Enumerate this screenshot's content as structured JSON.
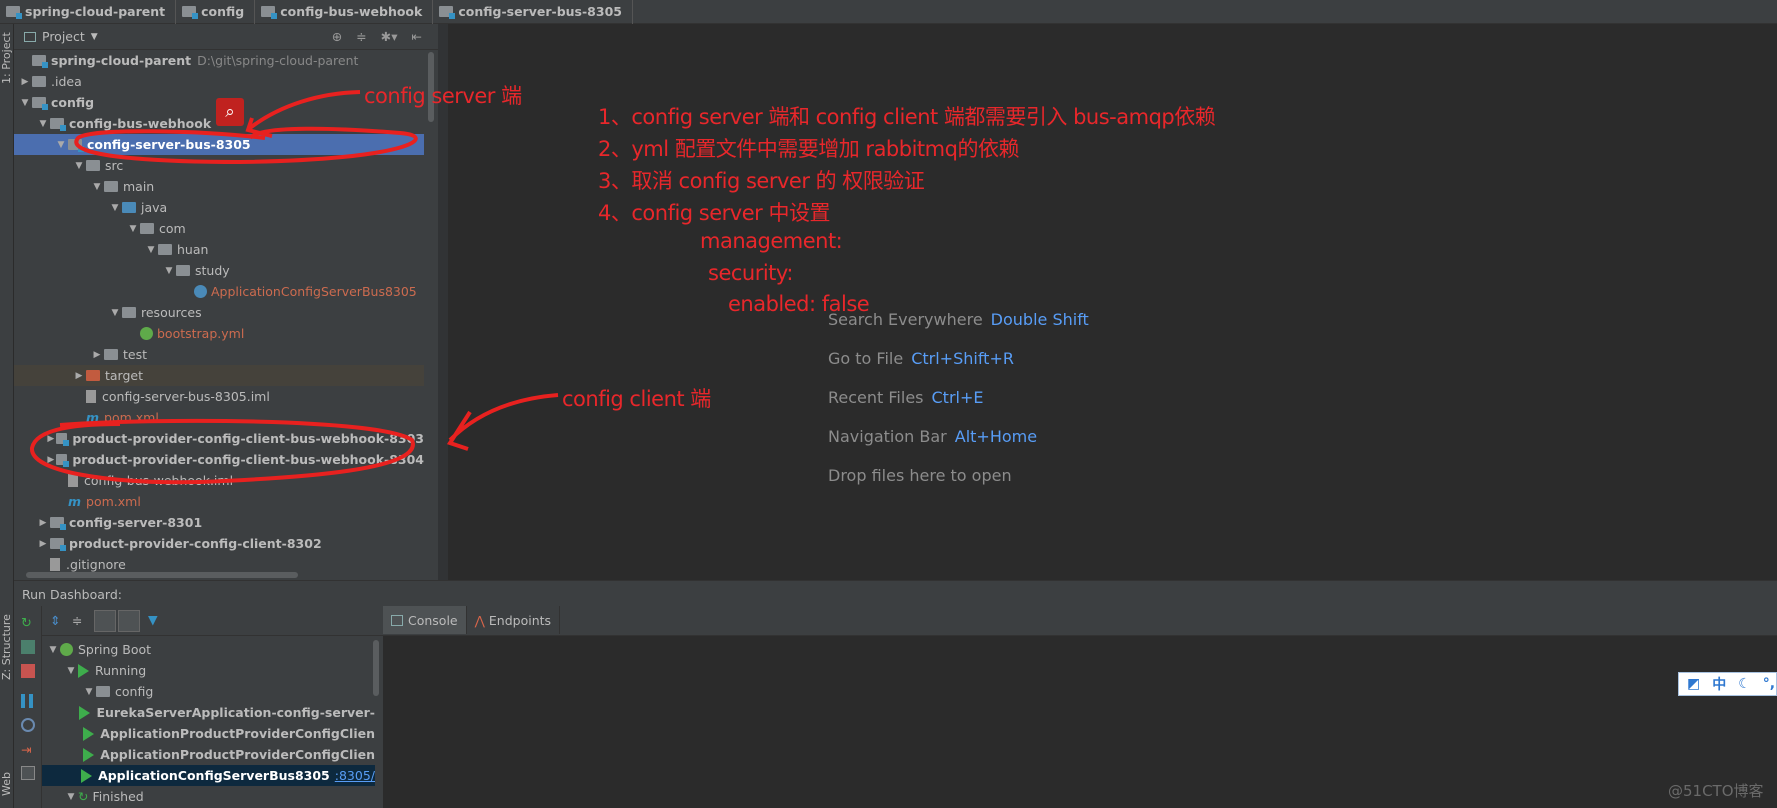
{
  "breadcrumb": [
    "spring-cloud-parent",
    "config",
    "config-bus-webhook",
    "config-server-bus-8305"
  ],
  "left_strip": {
    "project": "1: Project",
    "structure": "Z: Structure",
    "web": "Web"
  },
  "project_panel": {
    "title": "Project",
    "tree": [
      {
        "label": "spring-cloud-parent",
        "path": "D:\\git\\spring-cloud-parent",
        "level": 0,
        "expand": "none",
        "icon": "module-folder",
        "bold": true
      },
      {
        "label": ".idea",
        "level": 0,
        "expand": "collapsed",
        "icon": "folder"
      },
      {
        "label": "config",
        "level": 0,
        "expand": "expanded",
        "icon": "module-folder",
        "bold": true
      },
      {
        "label": "config-bus-webhook",
        "level": 1,
        "expand": "expanded",
        "icon": "module-folder",
        "bold": true
      },
      {
        "label": "config-server-bus-8305",
        "level": 2,
        "expand": "expanded",
        "icon": "module-folder",
        "bold": true,
        "selected": true
      },
      {
        "label": "src",
        "level": 3,
        "expand": "expanded",
        "icon": "folder"
      },
      {
        "label": "main",
        "level": 4,
        "expand": "expanded",
        "icon": "folder"
      },
      {
        "label": "java",
        "level": 5,
        "expand": "expanded",
        "icon": "source-folder"
      },
      {
        "label": "com",
        "level": 6,
        "expand": "expanded",
        "icon": "package"
      },
      {
        "label": "huan",
        "level": 7,
        "expand": "expanded",
        "icon": "package"
      },
      {
        "label": "study",
        "level": 8,
        "expand": "expanded",
        "icon": "package"
      },
      {
        "label": "ApplicationConfigServerBus8305",
        "level": 9,
        "expand": "none",
        "icon": "spring-boot-class",
        "color": "red"
      },
      {
        "label": "resources",
        "level": 5,
        "expand": "expanded",
        "icon": "resources-folder"
      },
      {
        "label": "bootstrap.yml",
        "level": 6,
        "expand": "none",
        "icon": "spring-yml",
        "color": "red"
      },
      {
        "label": "test",
        "level": 4,
        "expand": "collapsed",
        "icon": "folder"
      },
      {
        "label": "target",
        "level": 3,
        "expand": "collapsed",
        "icon": "excluded-folder",
        "highlight": true
      },
      {
        "label": "config-server-bus-8305.iml",
        "level": 3,
        "expand": "none",
        "icon": "iml-file"
      },
      {
        "label": "pom.xml",
        "level": 3,
        "expand": "none",
        "icon": "maven",
        "color": "red"
      },
      {
        "label": "product-provider-config-client-bus-webhook-8303",
        "level": 2,
        "expand": "collapsed",
        "icon": "module-folder",
        "bold": true
      },
      {
        "label": "product-provider-config-client-bus-webhook-8304",
        "level": 2,
        "expand": "collapsed",
        "icon": "module-folder",
        "bold": true
      },
      {
        "label": "config-bus-webhook.iml",
        "level": 2,
        "expand": "none",
        "icon": "iml-file"
      },
      {
        "label": "pom.xml",
        "level": 2,
        "expand": "none",
        "icon": "maven",
        "color": "red"
      },
      {
        "label": "config-server-8301",
        "level": 1,
        "expand": "collapsed",
        "icon": "module-folder",
        "bold": true
      },
      {
        "label": "product-provider-config-client-8302",
        "level": 1,
        "expand": "collapsed",
        "icon": "module-folder",
        "bold": true
      },
      {
        "label": ".gitignore",
        "level": 1,
        "expand": "none",
        "icon": "text-file"
      }
    ]
  },
  "annotations": {
    "server_label": "config server 端",
    "client_label": "config client 端",
    "notes": [
      "1、config server 端和 config client 端都需要引入 bus-amqp依赖",
      "2、yml 配置文件中需要增加 rabbitmq的依赖",
      "3、取消 config server 的 权限验证",
      "4、config server 中设置"
    ],
    "yaml": [
      "management:",
      "security:",
      "enabled: false"
    ],
    "color": "#e8272b"
  },
  "editor_hints": [
    {
      "label": "Search Everywhere",
      "key": "Double Shift"
    },
    {
      "label": "Go to File",
      "key": "Ctrl+Shift+R"
    },
    {
      "label": "Recent Files",
      "key": "Ctrl+E"
    },
    {
      "label": "Navigation Bar",
      "key": "Alt+Home"
    },
    {
      "label": "Drop files here to open",
      "key": ""
    }
  ],
  "run_dashboard": {
    "title": "Run Dashboard:",
    "tabs": [
      "Console",
      "Endpoints"
    ],
    "tree": [
      {
        "label": "Spring Boot",
        "level": 0,
        "icon": "spring-boot"
      },
      {
        "label": "Running",
        "level": 1,
        "icon": "run"
      },
      {
        "label": "config",
        "level": 2,
        "icon": "folder"
      },
      {
        "label": "EurekaServerApplication-config-server-",
        "level": 3,
        "icon": "run",
        "bold": true
      },
      {
        "label": "ApplicationProductProviderConfigClien",
        "level": 3,
        "icon": "run",
        "bold": true
      },
      {
        "label": "ApplicationProductProviderConfigClien",
        "level": 3,
        "icon": "run",
        "bold": true
      },
      {
        "label": "ApplicationConfigServerBus8305",
        "link": ":8305/",
        "level": 3,
        "icon": "run",
        "bold": true,
        "selected": true
      },
      {
        "label": "Finished",
        "level": 1,
        "icon": "rerun"
      }
    ]
  },
  "ime_toolbar": {
    "mode": "中"
  },
  "watermark": "@51CTO博客"
}
